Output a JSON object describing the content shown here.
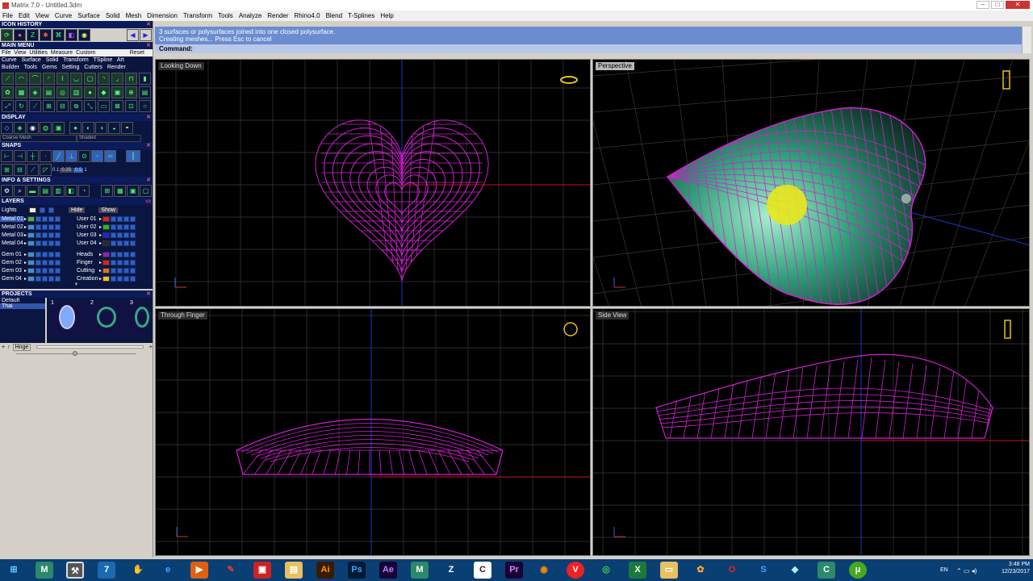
{
  "window": {
    "title": "Matrix 7.0 - Untitled.3dm"
  },
  "menubar": [
    "File",
    "Edit",
    "View",
    "Curve",
    "Surface",
    "Solid",
    "Mesh",
    "Dimension",
    "Transform",
    "Tools",
    "Analyze",
    "Render",
    "Rhino4.0",
    "Blend",
    "T-Splines",
    "Help"
  ],
  "left_panel": {
    "icon_history": "ICON HISTORY",
    "main_menu": "MAIN MENU",
    "menu_tabs": [
      "File",
      "View",
      "Utilities",
      "Measure",
      "Custom",
      "Reset"
    ],
    "menu_row1": [
      "Curve",
      "Surface",
      "Solid",
      "Transform",
      "TSpline",
      "Art"
    ],
    "menu_row2": [
      "Builder",
      "Tools",
      "Gems",
      "Setting",
      "Cutters",
      "Render"
    ],
    "display": "DISPLAY",
    "display_modes": [
      "Coarse Mesh",
      "Shaded"
    ],
    "snaps": "SNAPS",
    "snap_values": [
      "0.1",
      "0.25",
      "0.5",
      "1"
    ],
    "info_settings": "INFO & SETTINGS",
    "layers": "LAYERS",
    "layer_buttons": [
      "Hide",
      "Show"
    ],
    "lights": "Lights",
    "layers_left": [
      {
        "name": "Metal 01",
        "color": "#4ab04a",
        "selected": true
      },
      {
        "name": "Metal 02",
        "color": "#3a90e0",
        "selected": false
      },
      {
        "name": "Metal 03",
        "color": "#3a90e0",
        "selected": false
      },
      {
        "name": "Metal 04",
        "color": "#3a90e0",
        "selected": false
      },
      {
        "name": "Gem 01",
        "color": "#3a90e0",
        "selected": false
      },
      {
        "name": "Gem 02",
        "color": "#3a90e0",
        "selected": false
      },
      {
        "name": "Gem 03",
        "color": "#3a90e0",
        "selected": false
      },
      {
        "name": "Gem 04",
        "color": "#3a90e0",
        "selected": false
      }
    ],
    "layers_right": [
      {
        "name": "User 01",
        "color": "#e02020"
      },
      {
        "name": "User 02",
        "color": "#20c020"
      },
      {
        "name": "User 03",
        "color": "#2020e0"
      },
      {
        "name": "User 04",
        "color": "#2a2a2a"
      },
      {
        "name": "Heads",
        "color": "#9020c0"
      },
      {
        "name": "Finger",
        "color": "#e02020"
      },
      {
        "name": "Cutting",
        "color": "#e07020"
      },
      {
        "name": "Creation",
        "color": "#f0c020"
      }
    ],
    "projects": "PROJECTS",
    "project_items": [
      "Default",
      "Thai"
    ],
    "project_thumb_numbers": [
      "1",
      "2",
      "3"
    ],
    "hinge_label": "Hnge"
  },
  "command": {
    "line1": "3 surfaces or polysurfaces joined into one closed polysurface.",
    "line2": "Creating meshes... Press Esc to cancel",
    "prompt": "Command:"
  },
  "viewports": [
    {
      "label": "Looking Down",
      "active": false
    },
    {
      "label": "Perspective",
      "active": true
    },
    {
      "label": "Through Finger",
      "active": false
    },
    {
      "label": "Side View",
      "active": false
    }
  ],
  "taskbar": {
    "apps": [
      "start",
      "M",
      "tool",
      "7",
      "hand",
      "e",
      "media",
      "pen",
      "cam",
      "folder",
      "Ai",
      "Ps",
      "Ae",
      "M",
      "Z",
      "C",
      "Pr",
      "firefox",
      "vivaldi",
      "chrome",
      "X",
      "explorer",
      "paint",
      "opera",
      "S",
      "3d",
      "C",
      "utorrent"
    ],
    "lang": "EN",
    "time": "3:48 PM",
    "date": "12/23/2017"
  },
  "colors": {
    "wire": "#d020d0",
    "grid": "#3a3a3a",
    "axis_x": "#c01818",
    "axis_y": "#1838c8",
    "surface": "#2fa078",
    "highlight": "#e8e81c"
  }
}
